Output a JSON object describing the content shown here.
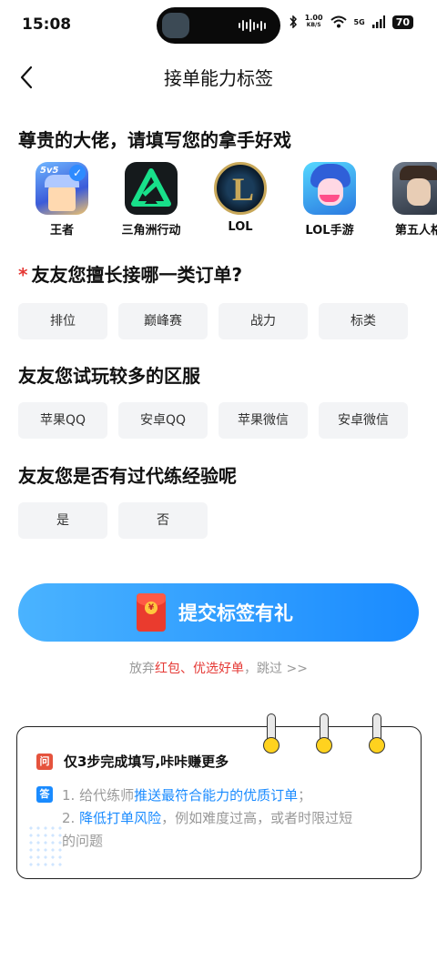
{
  "status_bar": {
    "time": "15:08",
    "speed_value": "1.00",
    "speed_unit": "KB/S",
    "network": "5G",
    "battery": "70"
  },
  "header": {
    "title": "接单能力标签"
  },
  "games_section": {
    "title": "尊贵的大佬，请填写您的拿手好戏",
    "items": [
      {
        "label": "王者",
        "selected": true
      },
      {
        "label": "三角洲行动",
        "selected": false
      },
      {
        "label": "LOL",
        "selected": false
      },
      {
        "label": "LOL手游",
        "selected": false
      },
      {
        "label": "第五人格",
        "selected": false
      }
    ]
  },
  "order_type_section": {
    "required_mark": "*",
    "title": "友友您擅长接哪一类订单?",
    "options": [
      "排位",
      "巅峰赛",
      "战力",
      "标类"
    ]
  },
  "server_section": {
    "title": "友友您试玩较多的区服",
    "options": [
      "苹果QQ",
      "安卓QQ",
      "苹果微信",
      "安卓微信"
    ]
  },
  "experience_section": {
    "title": "友友您是否有过代练经验呢",
    "options": [
      "是",
      "否"
    ]
  },
  "submit": {
    "label": "提交标签有礼",
    "coin_symbol": "¥"
  },
  "skip": {
    "prefix": "放弃",
    "highlight": "红包、优选好单",
    "suffix": "，跳过 >>"
  },
  "info_card": {
    "q_badge": "问",
    "question": "仅3步完成填写,咔咔赚更多",
    "a_badge": "答",
    "line1_prefix": "1. 给代练师",
    "line1_highlight": "推送最符合能力的优质订单",
    "line1_suffix": "；",
    "line2_prefix": "2. ",
    "line2_highlight": "降低打单风险",
    "line2_suffix": "，例如难度过高，或者时限过短",
    "line3": "的问题"
  },
  "colors": {
    "accent_blue": "#1a8bff",
    "accent_red": "#e53935",
    "chip_bg": "#f3f4f6"
  }
}
